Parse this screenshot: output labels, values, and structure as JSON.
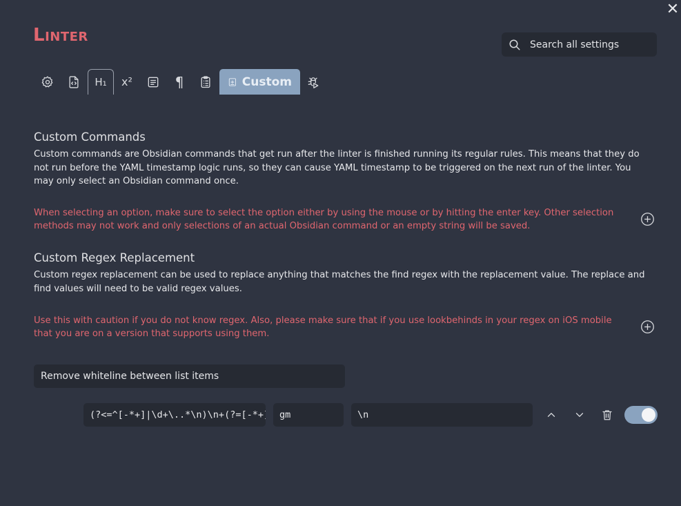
{
  "window": {
    "close_glyph": "✕"
  },
  "header": {
    "title": "Linter"
  },
  "search": {
    "placeholder": "Search all settings"
  },
  "tabs": [
    {
      "icon": "gear-icon"
    },
    {
      "icon": "file-code-icon"
    },
    {
      "label": "H₁"
    },
    {
      "label": "x²"
    },
    {
      "icon": "align-left-icon"
    },
    {
      "label": "¶"
    },
    {
      "icon": "clipboard-list-icon"
    },
    {
      "label": "Custom",
      "icon": "file-plus-icon",
      "active": true
    },
    {
      "icon": "bug-play-icon"
    }
  ],
  "custom_commands": {
    "heading": "Custom Commands",
    "description": "Custom commands are Obsidian commands that get run after the linter is finished running its regular rules. This means that they do not run before the YAML timestamp logic runs, so they can cause YAML timestamp to be triggered on the next run of the linter. You may only select an Obsidian command once.",
    "warning": "When selecting an option, make sure to select the option either by using the mouse or by hitting the enter key. Other selection methods may not work and only selections of an actual Obsidian command or an empty string will be saved."
  },
  "custom_regex": {
    "heading": "Custom Regex Replacement",
    "description": "Custom regex replacement can be used to replace anything that matches the find regex with the replacement value. The replace and find values will need to be valid regex values.",
    "warning": "Use this with caution if you do not know regex. Also, please make sure that if you use lookbehinds in your regex on iOS mobile that you are on a version that supports using them.",
    "entry": {
      "name": "Remove whiteline between list items",
      "find": "(?<=^[-*+]|\\d+\\..*\\n)\\n+(?=[-*+]|\\d",
      "flags": "gm",
      "replace": "\\n",
      "enabled": true
    }
  }
}
